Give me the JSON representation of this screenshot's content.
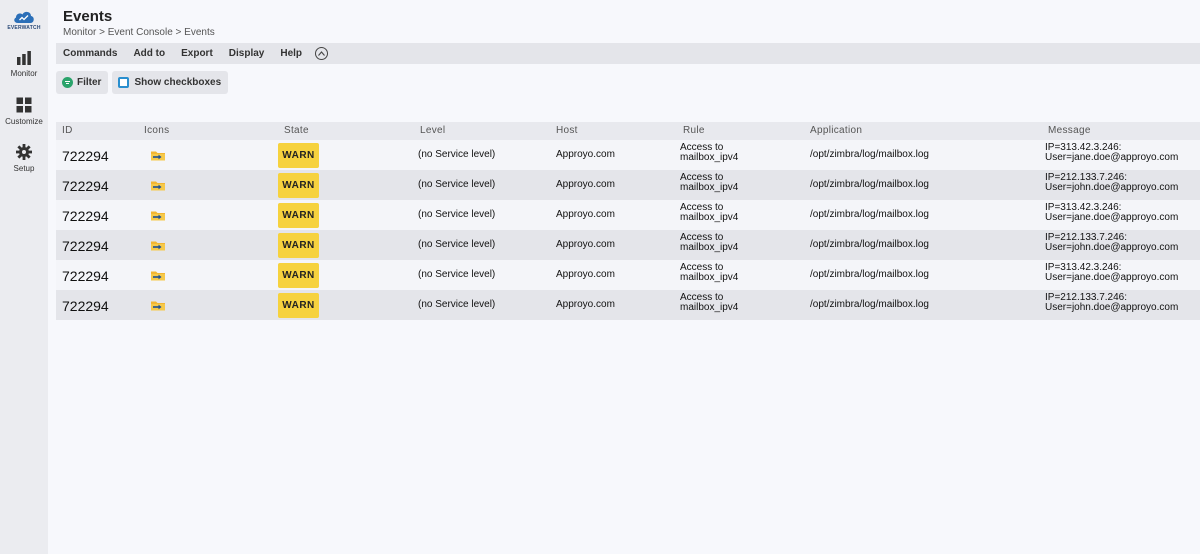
{
  "brand": {
    "name": "EVERWATCH",
    "color": "#2b6fb8"
  },
  "sidebar": {
    "items": [
      {
        "label": "Monitor",
        "icon": "bar-chart-icon"
      },
      {
        "label": "Customize",
        "icon": "grid-icon"
      },
      {
        "label": "Setup",
        "icon": "gear-icon"
      }
    ]
  },
  "header": {
    "title": "Events",
    "breadcrumb": "Monitor > Event Console > Events"
  },
  "menu": {
    "items": [
      "Commands",
      "Add to",
      "Export",
      "Display",
      "Help"
    ],
    "collapse_icon": "chevron-up-circle-icon"
  },
  "toolbar": {
    "filter_label": "Filter",
    "show_checkboxes_label": "Show checkboxes"
  },
  "table": {
    "columns": [
      "ID",
      "Icons",
      "State",
      "Level",
      "Host",
      "Rule",
      "Application",
      "Message"
    ],
    "rows": [
      {
        "id": "722294",
        "icon": "arrow-folder-icon",
        "state": "WARN",
        "level": "(no Service level)",
        "host": "Approyo.com",
        "rule_line1": "Access to",
        "rule_line2": "mailbox_ipv4",
        "application": "/opt/zimbra/log/mailbox.log",
        "message_line1": "IP=313.42.3.246:",
        "message_line2": "User=jane.doe@approyo.com"
      },
      {
        "id": "722294",
        "icon": "arrow-folder-icon",
        "state": "WARN",
        "level": "(no Service level)",
        "host": "Approyo.com",
        "rule_line1": "Access to",
        "rule_line2": "mailbox_ipv4",
        "application": "/opt/zimbra/log/mailbox.log",
        "message_line1": "IP=212.133.7.246:",
        "message_line2": "User=john.doe@approyo.com"
      },
      {
        "id": "722294",
        "icon": "arrow-folder-icon",
        "state": "WARN",
        "level": "(no Service level)",
        "host": "Approyo.com",
        "rule_line1": "Access to",
        "rule_line2": "mailbox_ipv4",
        "application": "/opt/zimbra/log/mailbox.log",
        "message_line1": "IP=313.42.3.246:",
        "message_line2": "User=jane.doe@approyo.com"
      },
      {
        "id": "722294",
        "icon": "arrow-folder-icon",
        "state": "WARN",
        "level": "(no Service level)",
        "host": "Approyo.com",
        "rule_line1": "Access to",
        "rule_line2": "mailbox_ipv4",
        "application": "/opt/zimbra/log/mailbox.log",
        "message_line1": "IP=212.133.7.246:",
        "message_line2": "User=john.doe@approyo.com"
      },
      {
        "id": "722294",
        "icon": "arrow-folder-icon",
        "state": "WARN",
        "level": "(no Service level)",
        "host": "Approyo.com",
        "rule_line1": "Access to",
        "rule_line2": "mailbox_ipv4",
        "application": "/opt/zimbra/log/mailbox.log",
        "message_line1": "IP=313.42.3.246:",
        "message_line2": "User=jane.doe@approyo.com"
      },
      {
        "id": "722294",
        "icon": "arrow-folder-icon",
        "state": "WARN",
        "level": "(no Service level)",
        "host": "Approyo.com",
        "rule_line1": "Access to",
        "rule_line2": "mailbox_ipv4",
        "application": "/opt/zimbra/log/mailbox.log",
        "message_line1": "IP=212.133.7.246:",
        "message_line2": "User=john.doe@approyo.com"
      }
    ]
  },
  "colors": {
    "warn": "#f6d23e",
    "filter_icon": "#2aa36b",
    "checkbox_icon": "#2a8fcf",
    "row_odd": "#f4f5f9",
    "row_even": "#e4e5ea"
  }
}
